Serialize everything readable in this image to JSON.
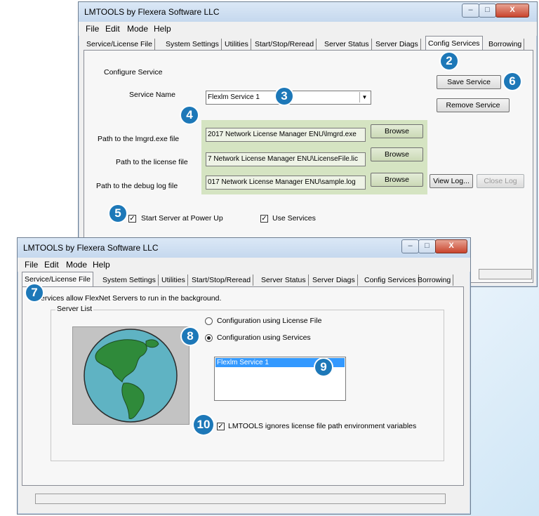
{
  "back_window": {
    "title": "LMTOOLS by Flexera Software LLC",
    "menu": [
      "File",
      "Edit",
      "Mode",
      "Help"
    ],
    "tabs": [
      "Service/License File",
      "System Settings",
      "Utilities",
      "Start/Stop/Reread",
      "Server Status",
      "Server Diags",
      "Config Services",
      "Borrowing"
    ],
    "active_tab": "Config Services",
    "section_label": "Configure Service",
    "service_name_label": "Service Name",
    "service_name_value": "Flexlm Service 1",
    "save_button": "Save Service",
    "remove_button": "Remove Service",
    "lmgrd_label": "Path to the lmgrd.exe file",
    "lmgrd_value": "2017 Network License Manager ENU\\lmgrd.exe",
    "license_label": "Path to the license file",
    "license_value": "7 Network License Manager ENU\\LicenseFile.lic",
    "debug_label": "Path to the debug log file",
    "debug_value": "017 Network License Manager ENU\\sample.log",
    "browse": "Browse",
    "view_log": "View Log...",
    "close_log": "Close Log",
    "start_power_up": "Start Server at Power Up",
    "use_services": "Use Services"
  },
  "front_window": {
    "title": "LMTOOLS by Flexera Software LLC",
    "menu": [
      "File",
      "Edit",
      "Mode",
      "Help"
    ],
    "tabs": [
      "Service/License File",
      "System Settings",
      "Utilities",
      "Start/Stop/Reread",
      "Server Status",
      "Server Diags",
      "Config Services",
      "Borrowing"
    ],
    "active_tab": "Service/License File",
    "info_text": "Services allow FlexNet Servers to run in the background.",
    "group_label": "Server List",
    "radio_license": "Configuration using License File",
    "radio_services": "Configuration using Services",
    "service_item": "Flexlm Service 1",
    "ignore_env": "LMTOOLS ignores license file path environment variables"
  },
  "badges": [
    "2",
    "3",
    "4",
    "5",
    "6",
    "7",
    "8",
    "9",
    "10"
  ],
  "colors": {
    "accent": "#1d78b8",
    "highlight": "#cfe0b8",
    "selection": "#3399ff"
  }
}
